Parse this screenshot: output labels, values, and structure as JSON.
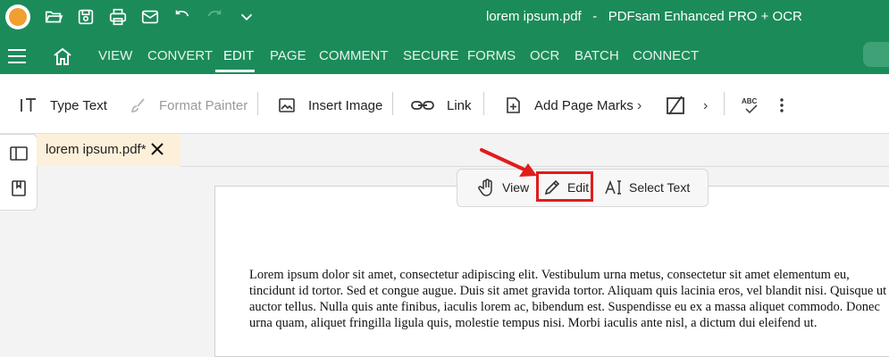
{
  "window": {
    "title": "lorem ipsum.pdf   -   PDFsam Enhanced PRO + OCR"
  },
  "quick_access": [
    "open-folder-icon",
    "save-icon",
    "print-icon",
    "mail-icon",
    "undo-icon",
    "redo-icon",
    "customize-chevron-icon"
  ],
  "menu": {
    "items": [
      "VIEW",
      "CONVERT",
      "EDIT",
      "PAGE",
      "COMMENT",
      "SECURE",
      "FORMS",
      "OCR",
      "BATCH",
      "CONNECT"
    ],
    "active": "EDIT"
  },
  "toolbar": {
    "type_text": "Type Text",
    "format_painter": "Format Painter",
    "insert_image": "Insert Image",
    "link": "Link",
    "add_page_marks": "Add Page Marks"
  },
  "document_tab": {
    "label": "lorem ipsum.pdf*"
  },
  "mode_bar": {
    "view": "View",
    "edit": "Edit",
    "select_text": "Select Text",
    "selected": "Edit"
  },
  "page": {
    "text": "Lorem ipsum dolor sit amet, consectetur adipiscing elit. Vestibulum urna metus, consectetur sit amet elementum eu, tincidunt id tortor. Sed et congue augue. Duis sit amet gravida tortor. Aliquam quis lacinia eros, vel blandit nisi. Quisque ut auctor tellus. Nulla quis ante finibus, iaculis lorem ac, bibendum est. Suspendisse eu ex a massa aliquet commodo. Donec urna quam, aliquet fringilla ligula quis, molestie tempus nisi. Morbi iaculis ante nisl, a dictum dui eleifend ut."
  },
  "colors": {
    "brand": "#1c8b5a",
    "highlight": "#e11c1c",
    "tab_bg": "#fdf0da"
  }
}
